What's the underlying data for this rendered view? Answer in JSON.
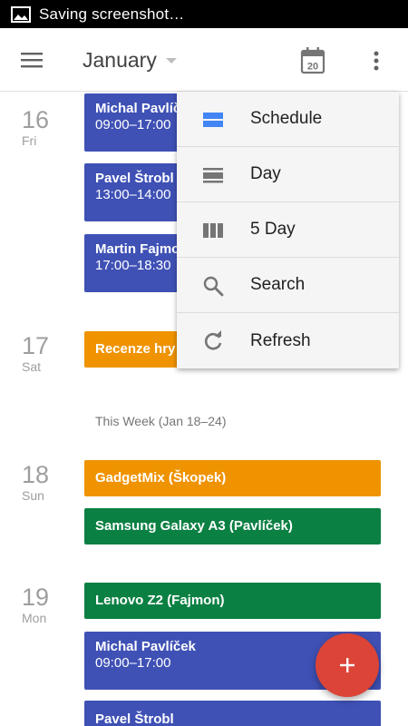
{
  "status_bar": {
    "text": "Saving screenshot…",
    "icon": "image-icon"
  },
  "app_bar": {
    "month": "January",
    "today_date": "20"
  },
  "menu": {
    "items": [
      {
        "label": "Schedule",
        "icon": "schedule-icon"
      },
      {
        "label": "Day",
        "icon": "day-view-icon"
      },
      {
        "label": "5 Day",
        "icon": "five-day-view-icon"
      },
      {
        "label": "Search",
        "icon": "search-icon"
      },
      {
        "label": "Refresh",
        "icon": "refresh-icon"
      }
    ]
  },
  "agenda": {
    "days": [
      {
        "num": "16",
        "dow": "Fri"
      },
      {
        "num": "17",
        "dow": "Sat"
      },
      {
        "num": "18",
        "dow": "Sun"
      },
      {
        "num": "19",
        "dow": "Mon"
      }
    ],
    "week_label": "This Week (Jan 18–24)",
    "events": [
      {
        "title": "Michal Pavlíček",
        "time": "09:00–17:00",
        "color": "#3f51b5"
      },
      {
        "title": "Pavel Štrobl",
        "time": "13:00–14:00",
        "color": "#3f51b5"
      },
      {
        "title": "Martin Fajmon",
        "time": "17:00–18:30",
        "color": "#3f51b5"
      },
      {
        "title": "Recenze hry",
        "color": "#f09300"
      },
      {
        "title": "GadgetMix (Škopek)",
        "color": "#f09300"
      },
      {
        "title": "Samsung Galaxy A3 (Pavlíček)",
        "color": "#0b8043"
      },
      {
        "title": "Lenovo Z2 (Fajmon)",
        "color": "#0b8043"
      },
      {
        "title": "Michal Pavlíček",
        "time": "09:00–17:00",
        "color": "#3f51b5"
      },
      {
        "title": "Pavel Štrobl",
        "color": "#3f51b5"
      }
    ]
  },
  "fab": {
    "icon": "add-icon",
    "color": "#db4437"
  }
}
